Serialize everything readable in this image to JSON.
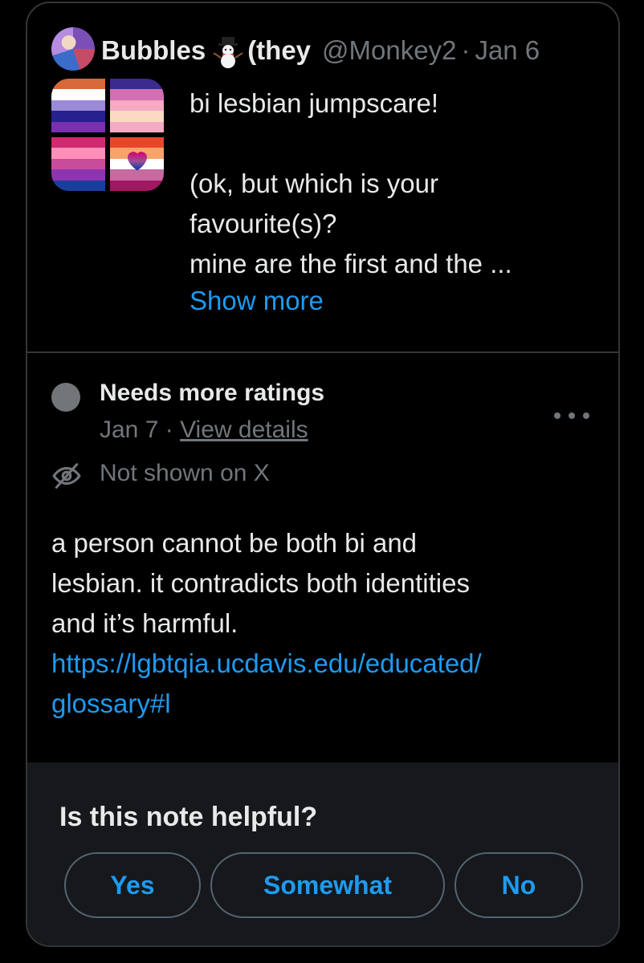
{
  "post": {
    "display_name": "Bubbles",
    "name_suffix": "(they",
    "handle": "@Monkey2",
    "separator": "·",
    "date": "Jan 6",
    "text": "bi lesbian jumpscare!\n\n(ok, but which is your\nfavourite(s)?\nmine are the first and the ...",
    "show_more": "Show more",
    "flags": [
      [
        "#d6683a",
        "#ffffff",
        "#9a8ad8",
        "#27208f",
        "#7a2fb0"
      ],
      [
        "#3b2a8f",
        "#d36fb2",
        "#f5a9c4",
        "#fcd9c2",
        "#f5a9c4"
      ],
      [
        "#d2286f",
        "#ff8fb6",
        "#c94c9a",
        "#8d35b0",
        "#1a3e9c"
      ],
      [
        "#e8452b",
        "#f7a36a",
        "#ffffff",
        "#c66aa0",
        "#a0185f"
      ]
    ]
  },
  "note": {
    "status": "Needs more ratings",
    "date": "Jan 7",
    "separator": "·",
    "view_details": "View details",
    "not_shown": "Not shown on X",
    "text": "a person cannot be both bi and\nlesbian. it contradicts both identities\nand it’s harmful.",
    "link": "https://lgbtqia.ucdavis.edu/educated/\nglossary#l"
  },
  "footer": {
    "question": "Is this note helpful?",
    "yes": "Yes",
    "somewhat": "Somewhat",
    "no": "No"
  },
  "colors": {
    "accent": "#1d9bf0",
    "muted": "#71767b",
    "border": "#333639"
  }
}
